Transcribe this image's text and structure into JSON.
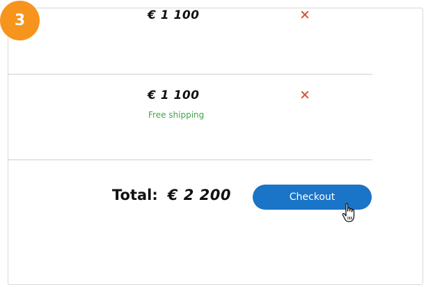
{
  "step": {
    "number": "3",
    "color": "#f7941d"
  },
  "items": [
    {
      "price": "€ 1 100",
      "shipping": ""
    },
    {
      "price": "€ 1 100",
      "shipping": "Free shipping"
    }
  ],
  "summary": {
    "total_label": "Total:",
    "total_value": "€ 2 200",
    "checkout_label": "Checkout"
  },
  "colors": {
    "accent": "#1a74c8",
    "remove": "#e0533c",
    "shipping": "#3fa64a"
  },
  "icons": {
    "remove": "close-icon",
    "cursor": "hand-pointer-icon"
  }
}
